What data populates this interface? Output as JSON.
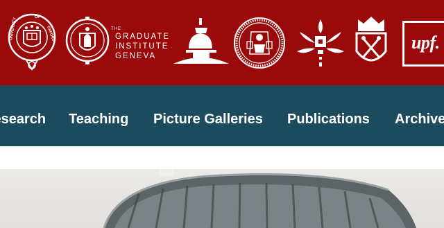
{
  "logos": [
    {
      "icon": "oxford-seal-icon",
      "ring_text": "UNIVERSITY OF OXFORD"
    },
    {
      "icon": "cambridge-crest-icon"
    },
    {
      "icon": "graduate-institute-geneva-logo-icon",
      "text_lines": [
        "THE",
        "GRADUATE",
        "INSTITUTE",
        "GENEVA"
      ]
    },
    {
      "icon": "charles-university-seal-icon"
    },
    {
      "icon": "helsinki-flame-icon"
    },
    {
      "icon": "uppsala-crest-icon"
    },
    {
      "icon": "upf-logo-icon",
      "text": "upf."
    }
  ],
  "nav": {
    "items": [
      "Research",
      "Teaching",
      "Picture Galleries",
      "Publications",
      "Archive"
    ]
  },
  "hero": {
    "icon": "dome-photo-icon"
  },
  "colors": {
    "brand_red": "#9b0a0a",
    "nav_teal": "#1b4b5c",
    "text_white": "#ffffff"
  }
}
